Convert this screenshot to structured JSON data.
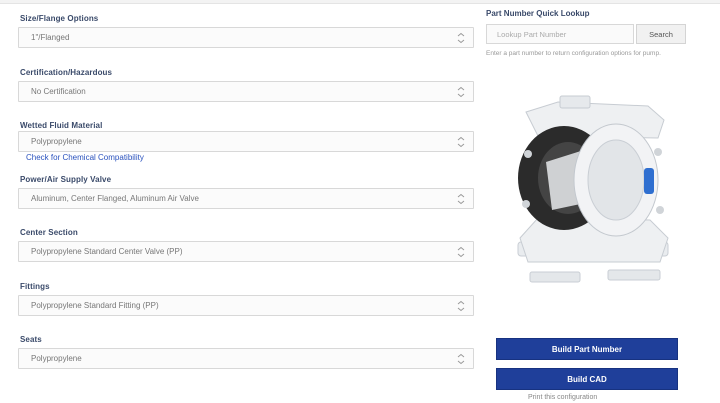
{
  "form": {
    "fields": [
      {
        "label": "Size/Flange Options",
        "value": "1\"/Flanged",
        "link": ""
      },
      {
        "label": "Certification/Hazardous",
        "value": "No Certification",
        "link": ""
      },
      {
        "label": "Wetted Fluid Material",
        "value": "Polypropylene",
        "link": "Check for Chemical Compatibility"
      },
      {
        "label": "Power/Air Supply Valve",
        "value": "Aluminum, Center Flanged, Aluminum Air Valve",
        "link": ""
      },
      {
        "label": "Center Section",
        "value": "Polypropylene Standard Center Valve (PP)",
        "link": ""
      },
      {
        "label": "Fittings",
        "value": "Polypropylene Standard Fitting (PP)",
        "link": ""
      },
      {
        "label": "Seats",
        "value": "Polypropylene",
        "link": ""
      }
    ]
  },
  "lookup": {
    "label": "Part Number Quick Lookup",
    "placeholder": "Lookup Part Number",
    "search_label": "Search",
    "help": "Enter a part number to return configuration options for pump."
  },
  "actions": {
    "primary_label": "Build Part Number",
    "secondary_label": "Build CAD",
    "small_link": "Print this configuration"
  },
  "colors": {
    "accent": "#1f3f9a",
    "link": "#2a52be",
    "label": "#3a4a6a"
  },
  "icons": {
    "select_chevron": "chevron-down-icon",
    "product": "diaphragm-pump-image"
  }
}
